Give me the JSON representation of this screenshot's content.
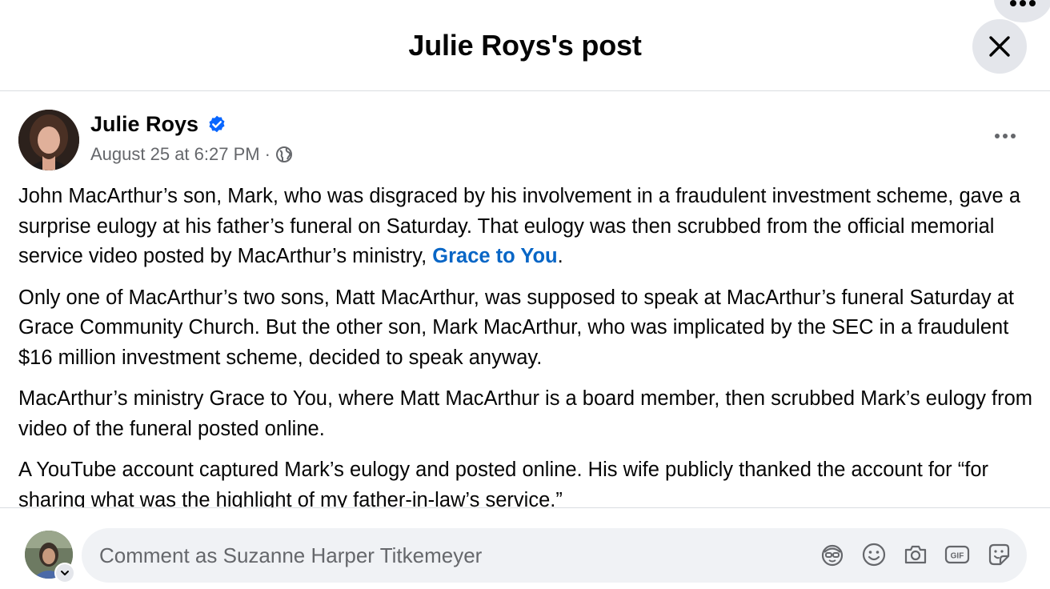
{
  "header": {
    "title": "Julie Roys's post"
  },
  "post": {
    "author": "Julie Roys",
    "verified": true,
    "timestamp": "August 25 at 6:27 PM",
    "separator": "·",
    "audience_icon": "globe-icon",
    "paragraphs": {
      "p1_before_link": "John MacArthur’s son, Mark, who was disgraced by his involvement in a fraudulent investment scheme, gave a surprise eulogy at his father’s funeral on Saturday. That eulogy was then scrubbed from the official memorial service video posted by MacArthur’s ministry, ",
      "p1_link": "Grace to You",
      "p1_after_link": ".",
      "p2": "Only one of MacArthur’s two sons, Matt MacArthur, was supposed to speak at MacArthur’s funeral Saturday at Grace Community Church. But the other son, Mark MacArthur, who was implicated by the SEC in a fraudulent $16 million investment scheme, decided to speak anyway.",
      "p3": "MacArthur’s ministry Grace to You, where Matt MacArthur is a board member, then scrubbed Mark’s eulogy from video of the funeral posted online.",
      "p4": "A YouTube account captured Mark’s eulogy and posted online. His wife publicly thanked the account for “for sharing what was the highlight of my father-in-law’s service.”"
    }
  },
  "comment": {
    "placeholder": "Comment as Suzanne Harper Titkemeyer",
    "icons": [
      "avatar-sticker-icon",
      "emoji-icon",
      "camera-icon",
      "gif-icon",
      "sticker-icon"
    ]
  },
  "colors": {
    "link": "#0866c6",
    "verified": "#0866ff",
    "secondary_text": "#65676b",
    "button_bg": "#e4e6eb",
    "input_bg": "#f0f2f5"
  }
}
